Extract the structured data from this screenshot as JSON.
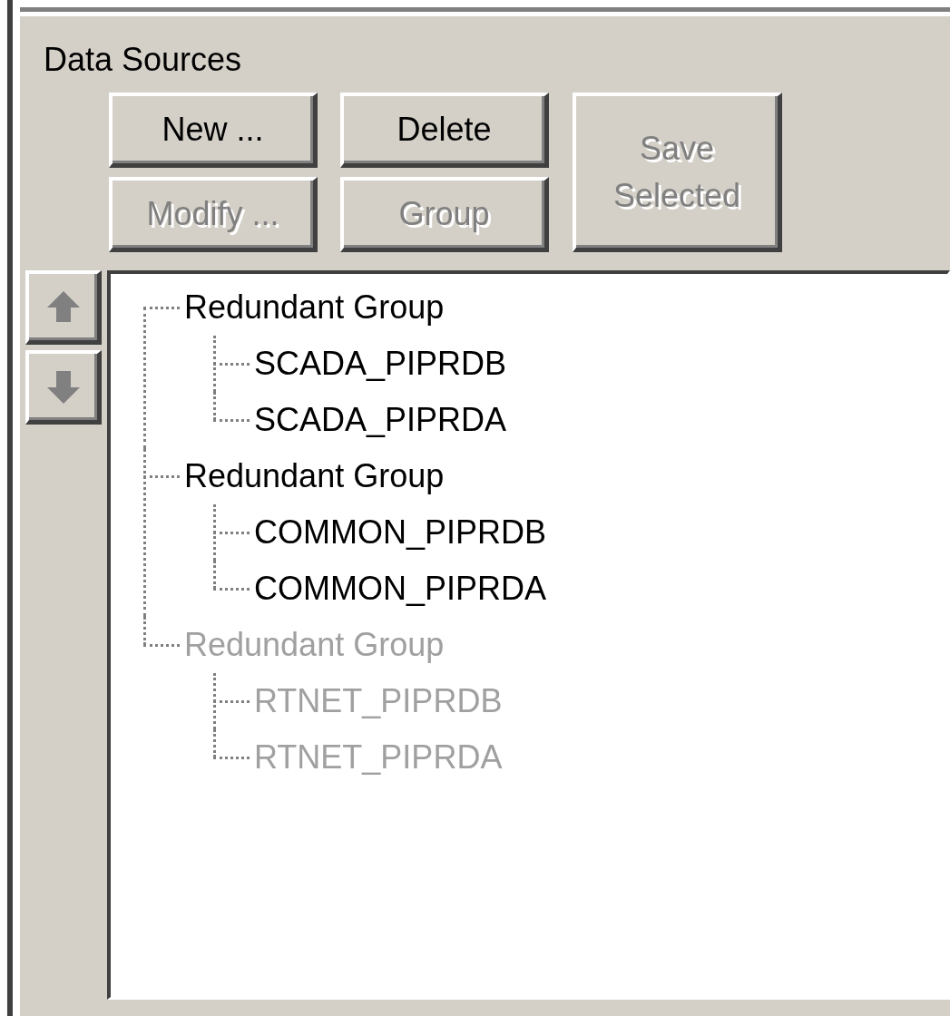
{
  "panel": {
    "title": "Data Sources"
  },
  "buttons": [
    {
      "label": "New ...",
      "disabled": false
    },
    {
      "label": "Delete",
      "disabled": false
    },
    {
      "label": "Save Selected",
      "disabled": true
    },
    {
      "label": "Modify ...",
      "disabled": true
    },
    {
      "label": "Group",
      "disabled": true
    }
  ],
  "move_buttons": [
    {
      "kind": "up",
      "disabled": true
    },
    {
      "kind": "down",
      "disabled": true
    }
  ],
  "tree": {
    "items": [
      {
        "label": "Redundant Group",
        "disabled": false,
        "children": [
          {
            "label": "SCADA_PIPRDB",
            "disabled": false
          },
          {
            "label": "SCADA_PIPRDA",
            "disabled": false
          }
        ]
      },
      {
        "label": "Redundant Group",
        "disabled": false,
        "children": [
          {
            "label": "COMMON_PIPRDB",
            "disabled": false
          },
          {
            "label": "COMMON_PIPRDA",
            "disabled": false
          }
        ]
      },
      {
        "label": "Redundant Group",
        "disabled": true,
        "children": [
          {
            "label": "RTNET_PIPRDB",
            "disabled": true
          },
          {
            "label": "RTNET_PIPRDA",
            "disabled": true
          }
        ]
      }
    ]
  }
}
